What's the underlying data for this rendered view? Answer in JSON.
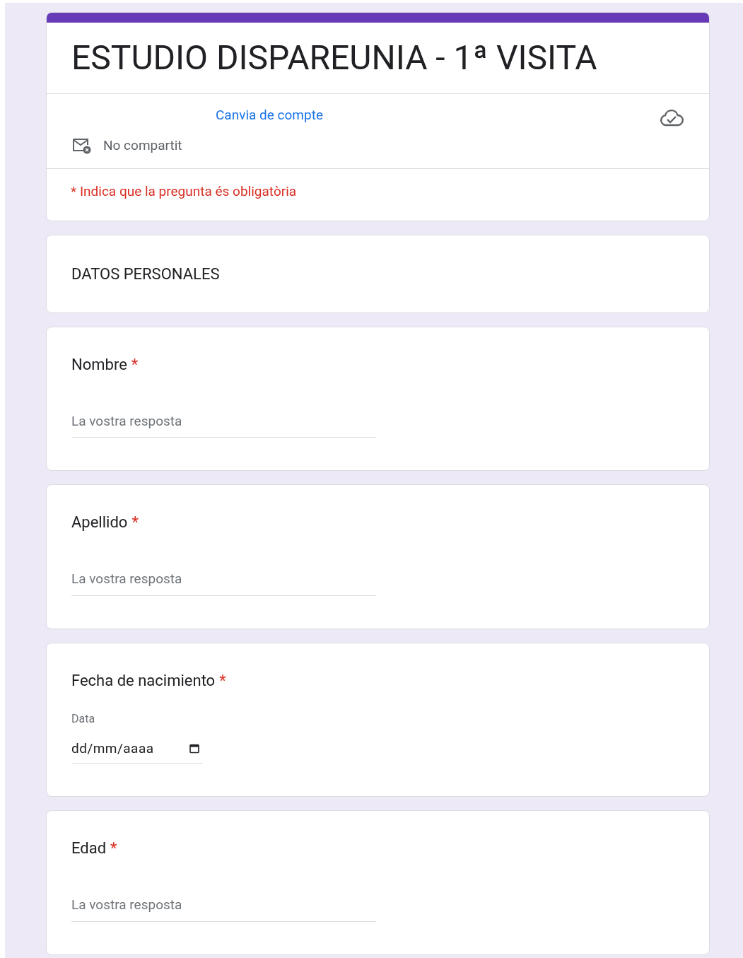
{
  "form": {
    "title": "ESTUDIO DISPAREUNIA - 1ª VISITA",
    "switch_account": "Canvia de compte",
    "sharing": "No compartit",
    "required_note": "* Indica que la pregunta és obligatòria"
  },
  "section": {
    "title": "DATOS PERSONALES"
  },
  "required_mark": "*",
  "questions": [
    {
      "kind": "text",
      "label": "Nombre",
      "required": true,
      "placeholder": "La vostra resposta"
    },
    {
      "kind": "text",
      "label": "Apellido",
      "required": true,
      "placeholder": "La vostra resposta"
    },
    {
      "kind": "date",
      "label": "Fecha de nacimiento",
      "required": true,
      "caption": "Data",
      "value": "dd/mm/aaaa"
    },
    {
      "kind": "text",
      "label": "Edad",
      "required": true,
      "placeholder": "La vostra resposta"
    }
  ]
}
